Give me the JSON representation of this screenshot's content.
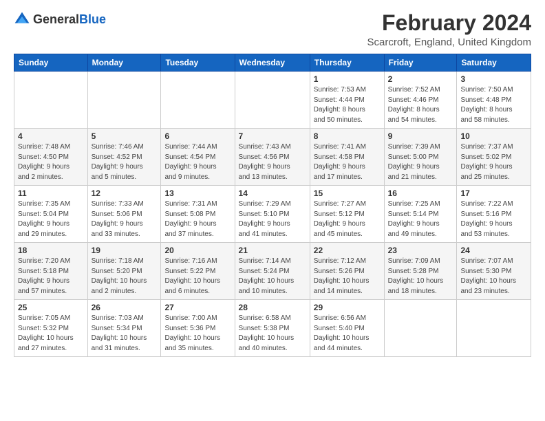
{
  "logo": {
    "general": "General",
    "blue": "Blue"
  },
  "title": "February 2024",
  "subtitle": "Scarcroft, England, United Kingdom",
  "calendar": {
    "headers": [
      "Sunday",
      "Monday",
      "Tuesday",
      "Wednesday",
      "Thursday",
      "Friday",
      "Saturday"
    ],
    "weeks": [
      [
        {
          "day": "",
          "info": ""
        },
        {
          "day": "",
          "info": ""
        },
        {
          "day": "",
          "info": ""
        },
        {
          "day": "",
          "info": ""
        },
        {
          "day": "1",
          "info": "Sunrise: 7:53 AM\nSunset: 4:44 PM\nDaylight: 8 hours\nand 50 minutes."
        },
        {
          "day": "2",
          "info": "Sunrise: 7:52 AM\nSunset: 4:46 PM\nDaylight: 8 hours\nand 54 minutes."
        },
        {
          "day": "3",
          "info": "Sunrise: 7:50 AM\nSunset: 4:48 PM\nDaylight: 8 hours\nand 58 minutes."
        }
      ],
      [
        {
          "day": "4",
          "info": "Sunrise: 7:48 AM\nSunset: 4:50 PM\nDaylight: 9 hours\nand 2 minutes."
        },
        {
          "day": "5",
          "info": "Sunrise: 7:46 AM\nSunset: 4:52 PM\nDaylight: 9 hours\nand 5 minutes."
        },
        {
          "day": "6",
          "info": "Sunrise: 7:44 AM\nSunset: 4:54 PM\nDaylight: 9 hours\nand 9 minutes."
        },
        {
          "day": "7",
          "info": "Sunrise: 7:43 AM\nSunset: 4:56 PM\nDaylight: 9 hours\nand 13 minutes."
        },
        {
          "day": "8",
          "info": "Sunrise: 7:41 AM\nSunset: 4:58 PM\nDaylight: 9 hours\nand 17 minutes."
        },
        {
          "day": "9",
          "info": "Sunrise: 7:39 AM\nSunset: 5:00 PM\nDaylight: 9 hours\nand 21 minutes."
        },
        {
          "day": "10",
          "info": "Sunrise: 7:37 AM\nSunset: 5:02 PM\nDaylight: 9 hours\nand 25 minutes."
        }
      ],
      [
        {
          "day": "11",
          "info": "Sunrise: 7:35 AM\nSunset: 5:04 PM\nDaylight: 9 hours\nand 29 minutes."
        },
        {
          "day": "12",
          "info": "Sunrise: 7:33 AM\nSunset: 5:06 PM\nDaylight: 9 hours\nand 33 minutes."
        },
        {
          "day": "13",
          "info": "Sunrise: 7:31 AM\nSunset: 5:08 PM\nDaylight: 9 hours\nand 37 minutes."
        },
        {
          "day": "14",
          "info": "Sunrise: 7:29 AM\nSunset: 5:10 PM\nDaylight: 9 hours\nand 41 minutes."
        },
        {
          "day": "15",
          "info": "Sunrise: 7:27 AM\nSunset: 5:12 PM\nDaylight: 9 hours\nand 45 minutes."
        },
        {
          "day": "16",
          "info": "Sunrise: 7:25 AM\nSunset: 5:14 PM\nDaylight: 9 hours\nand 49 minutes."
        },
        {
          "day": "17",
          "info": "Sunrise: 7:22 AM\nSunset: 5:16 PM\nDaylight: 9 hours\nand 53 minutes."
        }
      ],
      [
        {
          "day": "18",
          "info": "Sunrise: 7:20 AM\nSunset: 5:18 PM\nDaylight: 9 hours\nand 57 minutes."
        },
        {
          "day": "19",
          "info": "Sunrise: 7:18 AM\nSunset: 5:20 PM\nDaylight: 10 hours\nand 2 minutes."
        },
        {
          "day": "20",
          "info": "Sunrise: 7:16 AM\nSunset: 5:22 PM\nDaylight: 10 hours\nand 6 minutes."
        },
        {
          "day": "21",
          "info": "Sunrise: 7:14 AM\nSunset: 5:24 PM\nDaylight: 10 hours\nand 10 minutes."
        },
        {
          "day": "22",
          "info": "Sunrise: 7:12 AM\nSunset: 5:26 PM\nDaylight: 10 hours\nand 14 minutes."
        },
        {
          "day": "23",
          "info": "Sunrise: 7:09 AM\nSunset: 5:28 PM\nDaylight: 10 hours\nand 18 minutes."
        },
        {
          "day": "24",
          "info": "Sunrise: 7:07 AM\nSunset: 5:30 PM\nDaylight: 10 hours\nand 23 minutes."
        }
      ],
      [
        {
          "day": "25",
          "info": "Sunrise: 7:05 AM\nSunset: 5:32 PM\nDaylight: 10 hours\nand 27 minutes."
        },
        {
          "day": "26",
          "info": "Sunrise: 7:03 AM\nSunset: 5:34 PM\nDaylight: 10 hours\nand 31 minutes."
        },
        {
          "day": "27",
          "info": "Sunrise: 7:00 AM\nSunset: 5:36 PM\nDaylight: 10 hours\nand 35 minutes."
        },
        {
          "day": "28",
          "info": "Sunrise: 6:58 AM\nSunset: 5:38 PM\nDaylight: 10 hours\nand 40 minutes."
        },
        {
          "day": "29",
          "info": "Sunrise: 6:56 AM\nSunset: 5:40 PM\nDaylight: 10 hours\nand 44 minutes."
        },
        {
          "day": "",
          "info": ""
        },
        {
          "day": "",
          "info": ""
        }
      ]
    ]
  }
}
